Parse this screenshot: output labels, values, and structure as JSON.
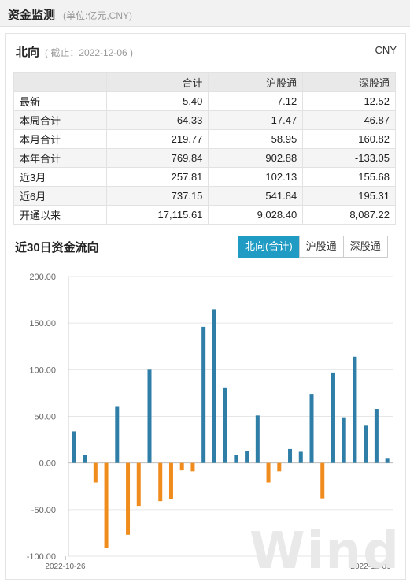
{
  "header": {
    "title": "资金监测",
    "unit": "(单位:亿元,CNY)"
  },
  "northbound": {
    "title": "北向",
    "date": "( 截止：2022-12-06 )",
    "currency": "CNY",
    "columns": [
      "",
      "合计",
      "沪股通",
      "深股通"
    ],
    "rows": [
      [
        "最新",
        "5.40",
        "-7.12",
        "12.52"
      ],
      [
        "本周合计",
        "64.33",
        "17.47",
        "46.87"
      ],
      [
        "本月合计",
        "219.77",
        "58.95",
        "160.82"
      ],
      [
        "本年合计",
        "769.84",
        "902.88",
        "-133.05"
      ],
      [
        "近3月",
        "257.81",
        "102.13",
        "155.68"
      ],
      [
        "近6月",
        "737.15",
        "541.84",
        "195.31"
      ],
      [
        "开通以来",
        "17,115.61",
        "9,028.40",
        "8,087.22"
      ]
    ]
  },
  "flow30": {
    "title": "近30日资金流向",
    "tabs": [
      "北向(合计)",
      "沪股通",
      "深股通"
    ],
    "active_tab": 0
  },
  "watermark": "Wind",
  "colors": {
    "positive": "#2e7ea8",
    "negative": "#f08c1e",
    "accent": "#1f9bc4"
  },
  "chart_data": {
    "type": "bar",
    "x_start_label": "2022-10-26",
    "x_end_label": "2022-12-06",
    "ylim": [
      -100,
      200
    ],
    "yticks": [
      "200.00",
      "150.00",
      "100.00",
      "50.00",
      "0.00",
      "-50.00",
      "-100.00"
    ],
    "values": [
      34,
      9,
      -21,
      -91,
      61,
      -77,
      -46,
      100,
      -41,
      -39,
      -8,
      -9,
      146,
      165,
      81,
      9,
      13,
      51,
      -21,
      -9,
      15,
      12,
      74,
      -38,
      97,
      49,
      114,
      40,
      58,
      5.4
    ]
  }
}
